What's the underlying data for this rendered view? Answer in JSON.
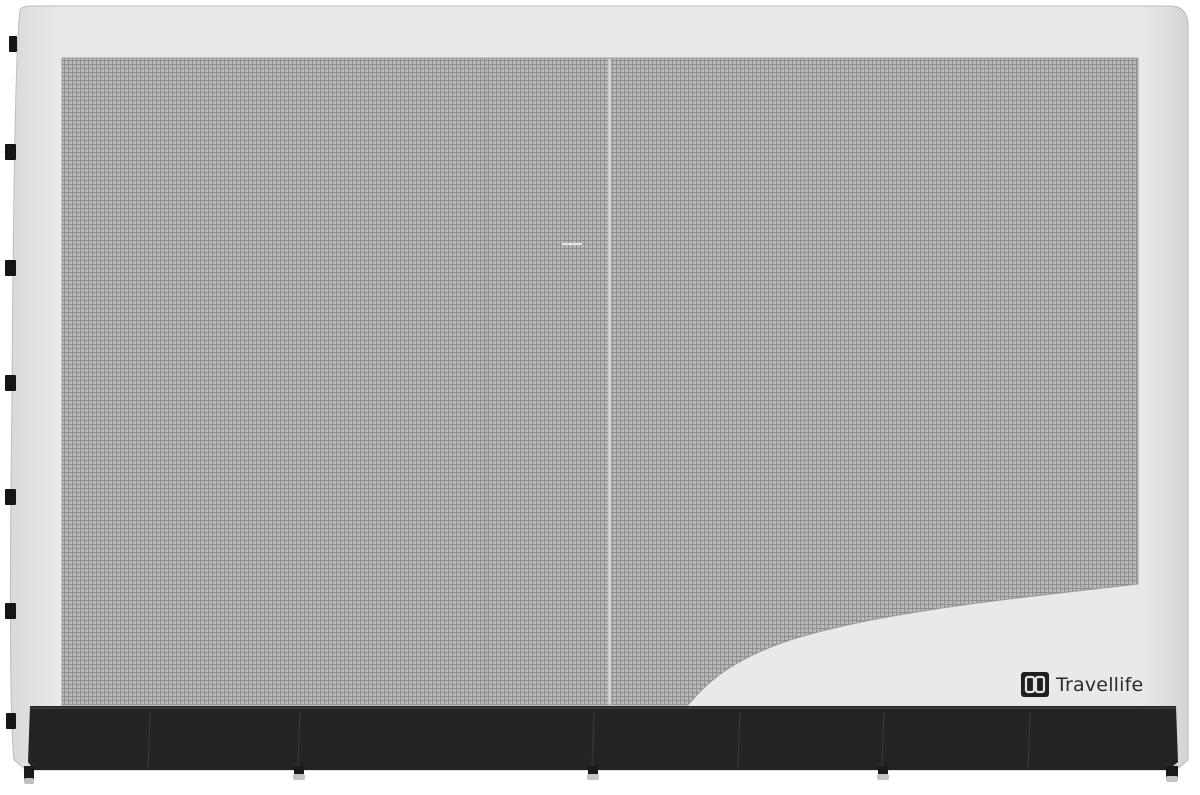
{
  "brand": {
    "name": "Travellife",
    "logo_icon": "travellife-logo-icon"
  },
  "colors": {
    "fabric": "#e6e6e6",
    "fabric_shadow": "#cfcfcf",
    "mesh": "#a9a9a9",
    "mesh_dark": "#8f8f8f",
    "skirt": "#232323",
    "strap": "#151515"
  }
}
